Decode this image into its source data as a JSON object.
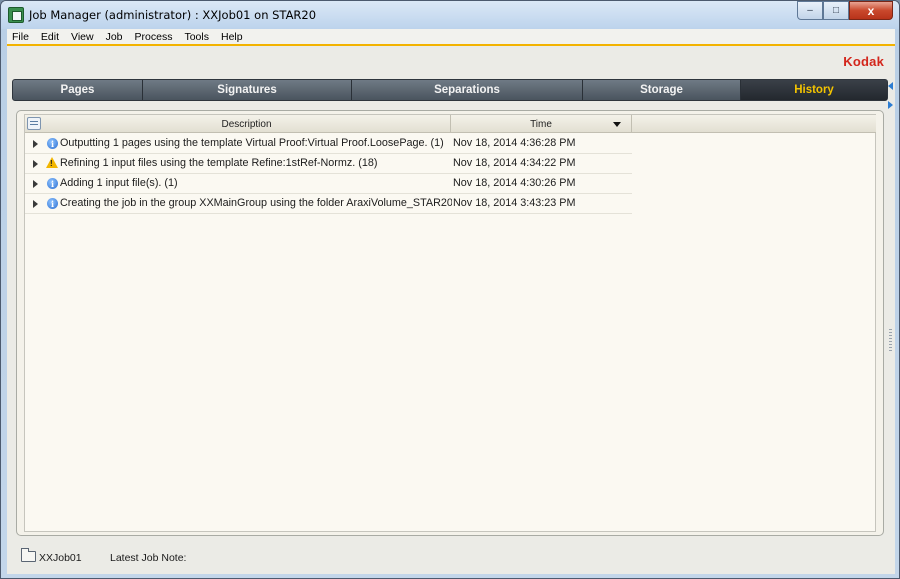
{
  "window": {
    "title": "Job Manager (administrator) : XXJob01 on STAR20",
    "controls": {
      "minimize": "–",
      "maximize": "□",
      "close": "x"
    }
  },
  "menu": [
    "File",
    "Edit",
    "View",
    "Job",
    "Process",
    "Tools",
    "Help"
  ],
  "brand": "Kodak",
  "tabs": [
    {
      "label": "Pages",
      "active": false
    },
    {
      "label": "Signatures",
      "active": false
    },
    {
      "label": "Separations",
      "active": false
    },
    {
      "label": "Storage",
      "active": false
    },
    {
      "label": "History",
      "active": true
    }
  ],
  "colors": {
    "tab_active_text": "#f4c400",
    "brand": "#d3261c",
    "menu_accent": "#f3b300"
  },
  "history": {
    "columns": {
      "description": "Description",
      "time": "Time"
    },
    "rows": [
      {
        "icon": "info-icon",
        "description": "Outputting 1 pages using the template Virtual Proof:Virtual Proof.LoosePage. (1)",
        "time": "Nov 18, 2014 4:36:28 PM"
      },
      {
        "icon": "warning-icon",
        "description": "Refining 1 input files using the template Refine:1stRef-Normz. (18)",
        "time": "Nov 18, 2014 4:34:22 PM"
      },
      {
        "icon": "info-icon",
        "description": "Adding 1 input file(s). (1)",
        "time": "Nov 18, 2014 4:30:26 PM"
      },
      {
        "icon": "info-icon",
        "description": "Creating the job in the group XXMainGroup using the folder AraxiVolume_STAR20",
        "time": "Nov 18, 2014 3:43:23 PM"
      }
    ]
  },
  "status": {
    "job_name": "XXJob01",
    "note_label": "Latest Job Note:"
  }
}
